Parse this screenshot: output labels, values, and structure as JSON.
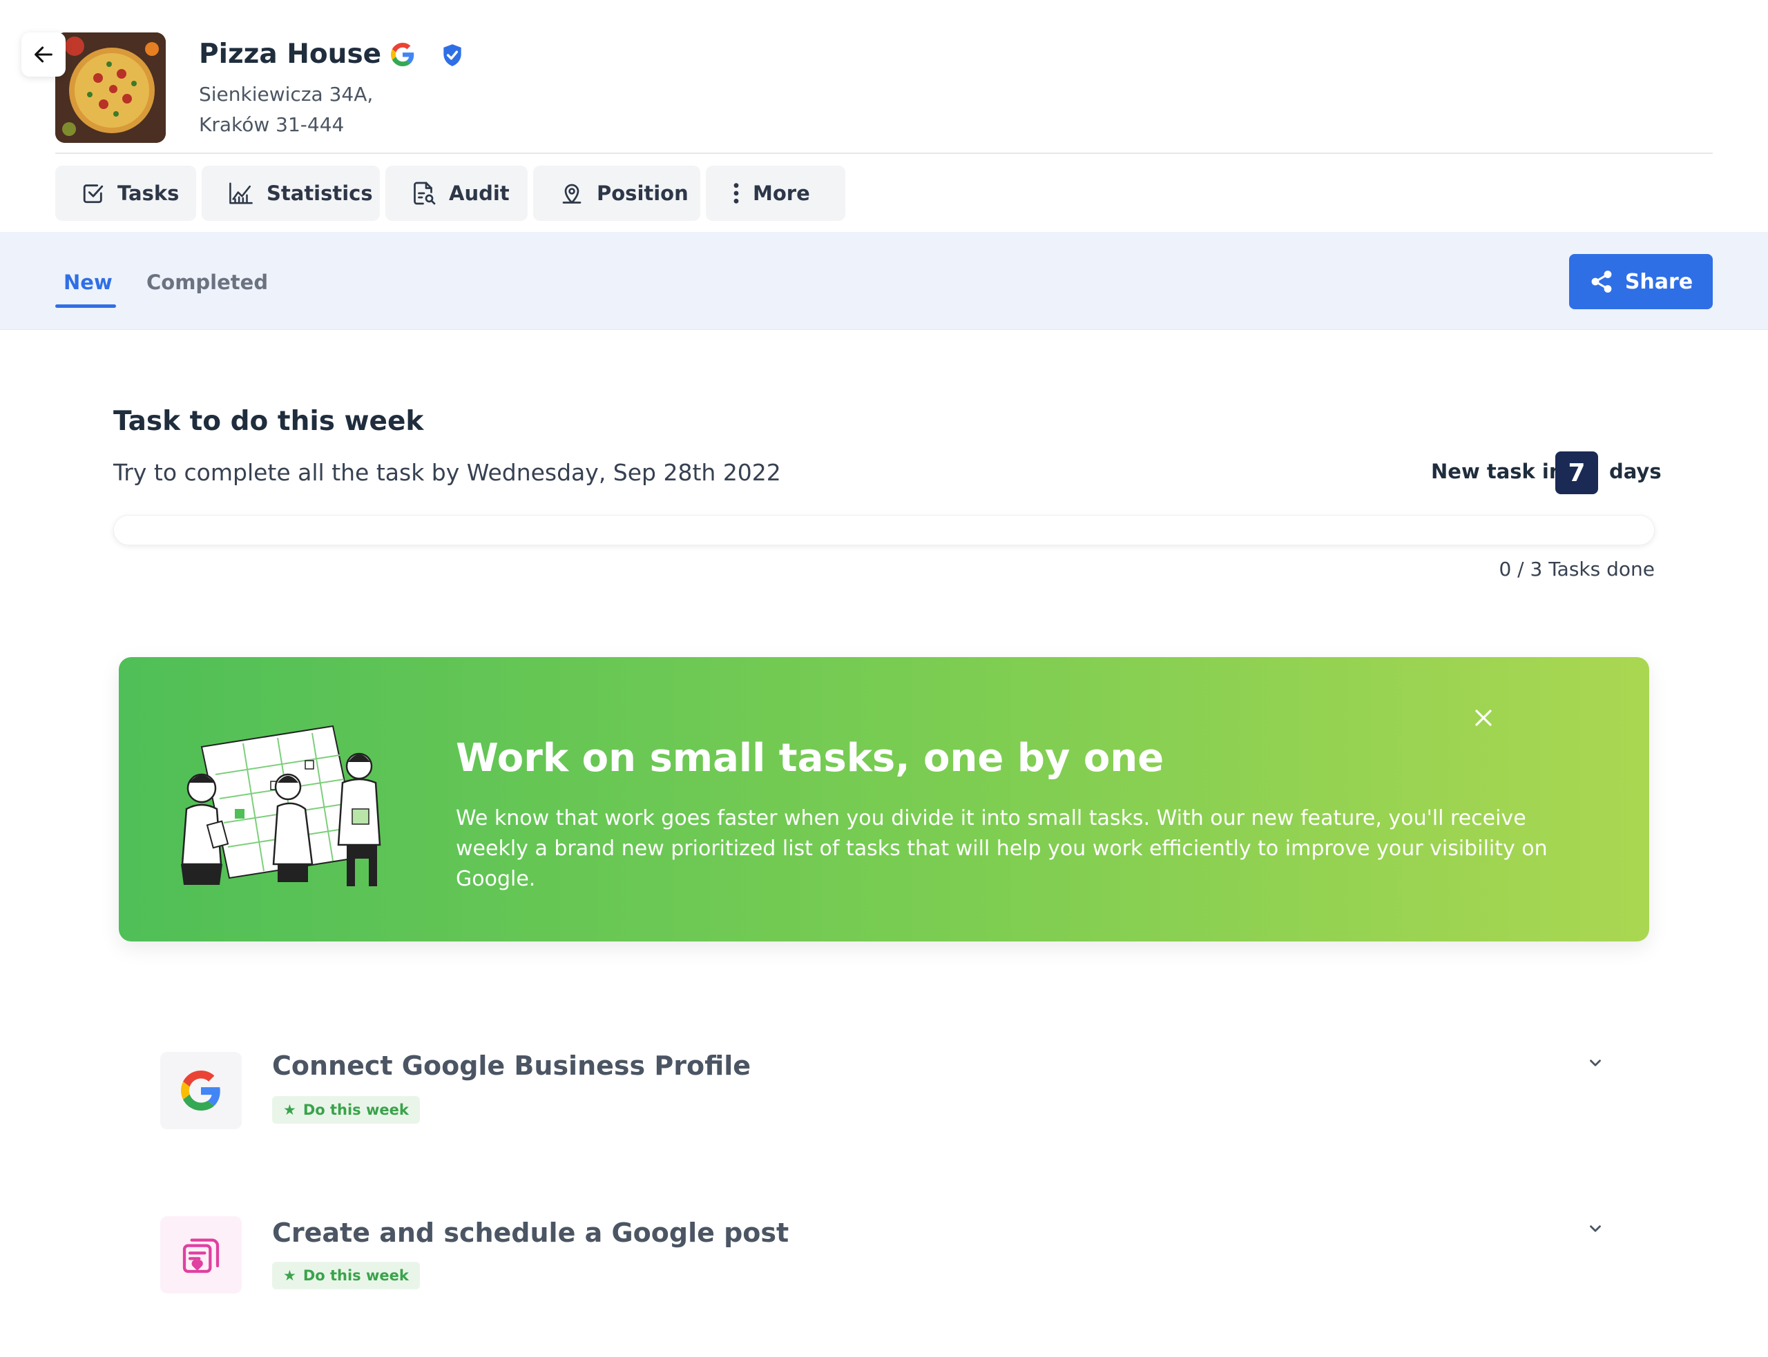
{
  "business": {
    "name": "Pizza House",
    "address_line1": "Sienkiewicza 34A,",
    "address_line2": "Kraków 31-444"
  },
  "nav": {
    "tasks": "Tasks",
    "statistics": "Statistics",
    "audit": "Audit",
    "position": "Position",
    "more": "More"
  },
  "tabs": {
    "new": "New",
    "completed": "Completed"
  },
  "share_label": "Share",
  "week": {
    "title": "Task to do this week",
    "subtitle": "Try to complete all the task by Wednesday, Sep 28th 2022",
    "new_task_label": "New task in",
    "days_count": "7",
    "days_word": "days",
    "progress_text": "0 / 3 Tasks done",
    "progress_fraction": 0
  },
  "banner": {
    "title": "Work on small tasks, one by one",
    "text": "We know that work goes faster when you divide it into small tasks. With our new feature, you'll receive weekly a brand new prioritized list of tasks that will help you work efficiently to improve your visibility on Google."
  },
  "tasks": [
    {
      "title": "Connect Google Business Profile",
      "tag": "Do this week",
      "icon": "google-icon"
    },
    {
      "title": "Create and schedule a Google post",
      "tag": "Do this week",
      "icon": "post-icon"
    }
  ],
  "colors": {
    "accent": "#2f6fe6",
    "banner_start": "#4fbf57",
    "banner_end": "#aad752",
    "tag_text": "#3aa34b",
    "days_box": "#1a2a55"
  }
}
